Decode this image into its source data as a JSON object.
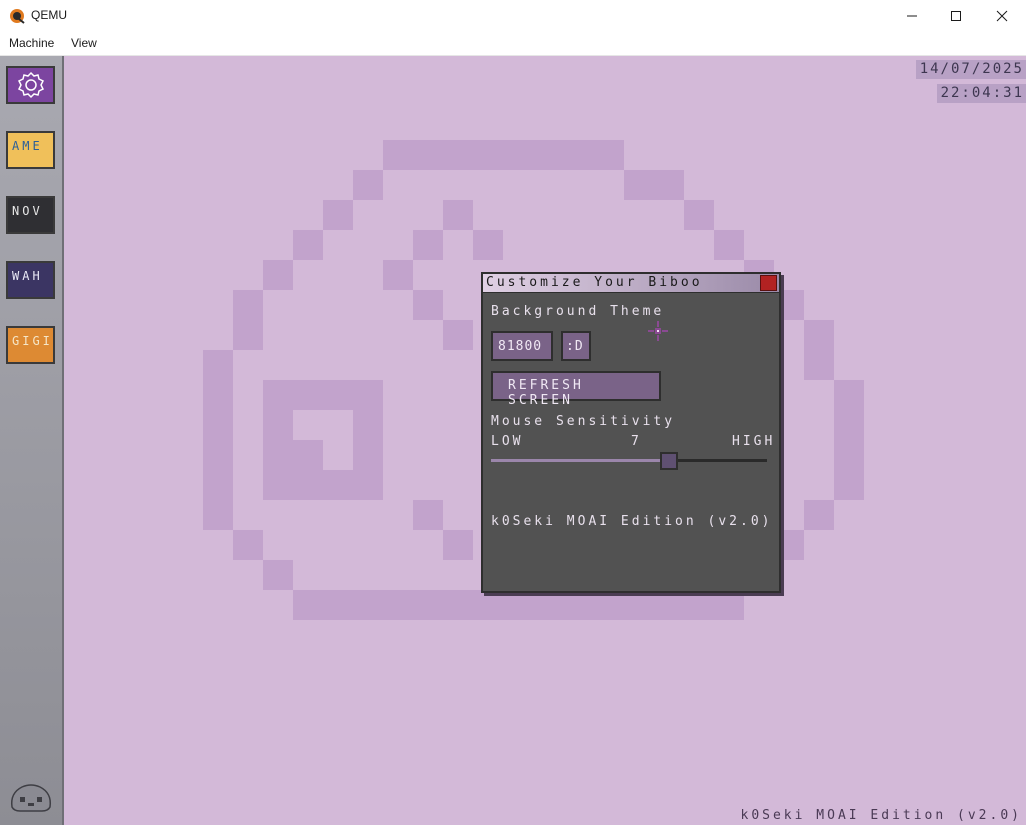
{
  "window": {
    "title": "QEMU",
    "menu": [
      "Machine",
      "View"
    ]
  },
  "sidebar": {
    "buttons": [
      {
        "label": "",
        "icon": "gear-icon",
        "bg": "#7c45a0",
        "fg": "#ffffff"
      },
      {
        "label": "AME",
        "bg": "#f0c05a",
        "fg": "#2b5f9a"
      },
      {
        "label": "NOV",
        "bg": "#2f2f33",
        "fg": "#e8e8e8"
      },
      {
        "label": "WAH",
        "bg": "#3b3563",
        "fg": "#e8e8f5"
      },
      {
        "label": "GIGI",
        "bg": "#dd8a33",
        "fg": "#f5e6c8"
      }
    ]
  },
  "clock": {
    "date": "14/07/2025",
    "time": "22:04:31"
  },
  "dialog": {
    "title": "Customize Your Biboo",
    "bg_theme_label": "Background Theme",
    "theme_value": "81800",
    "theme_suffix": ":D",
    "refresh_label": "REFRESH SCREEN",
    "sensitivity_label": "Mouse Sensitivity",
    "low_label": "LOW",
    "value_label": "7",
    "high_label": "HIGH",
    "sensitivity_fraction": 0.65,
    "edition": "k0Seki MOAI Edition (v2.0)"
  },
  "footer": {
    "edition": "k0Seki MOAI Edition (v2.0)"
  },
  "colors": {
    "desktop_bg": "#d3b9d8",
    "logo": "#c2a3cc",
    "accent": "#7c45a0"
  }
}
